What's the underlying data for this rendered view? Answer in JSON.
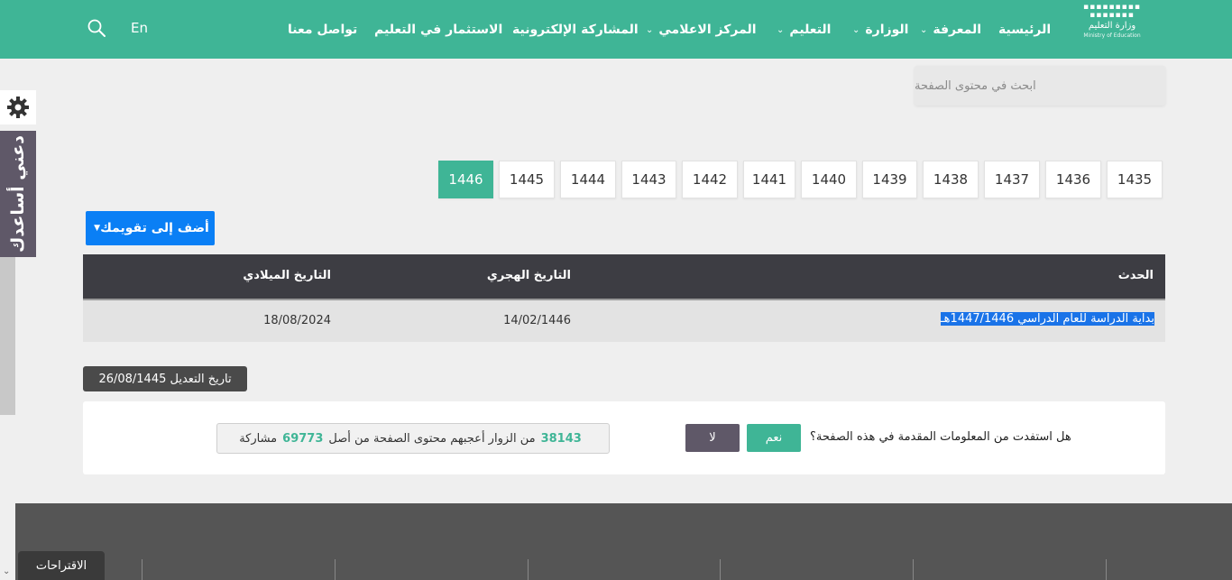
{
  "header": {
    "logo": {
      "arabic": "وزارة التعليم",
      "english": "Ministry of Education"
    },
    "nav": [
      {
        "label": "الرئيسية",
        "dropdown": false
      },
      {
        "label": "المعرفة",
        "dropdown": true
      },
      {
        "label": "الوزارة",
        "dropdown": true
      },
      {
        "label": "التعليم",
        "dropdown": true
      },
      {
        "label": "المركز الاعلامي",
        "dropdown": true
      },
      {
        "label": "المشاركة الإلكترونية",
        "dropdown": false
      },
      {
        "label": "الاستثمار في التعليم",
        "dropdown": false
      },
      {
        "label": "تواصل معنا",
        "dropdown": false
      }
    ],
    "lang_label": "En"
  },
  "page_search": {
    "placeholder": "ابحث في محتوى الصفحة"
  },
  "help_widget": {
    "label": "دعني أساعدك"
  },
  "years": [
    "1435",
    "1436",
    "1437",
    "1438",
    "1439",
    "1440",
    "1441",
    "1442",
    "1443",
    "1444",
    "1445",
    "1446"
  ],
  "active_year": "1446",
  "calendar_button": {
    "label": "أضف إلى تقويمك"
  },
  "table": {
    "headers": {
      "event": "الحدث",
      "hijri": "التاريخ الهجري",
      "gregorian": "التاريخ الميلادي"
    },
    "rows": [
      {
        "event": "بداية الدراسة للعام الدراسي 1447/1446هـ",
        "hijri": "14/02/1446",
        "gregorian": "18/08/2024"
      }
    ]
  },
  "modified_date": "تاريخ التعديل 26/08/1445",
  "feedback": {
    "question": "هل استفدت من المعلومات المقدمة في هذه الصفحة؟",
    "yes_label": "نعم",
    "no_label": "لا",
    "liked_count": "38143",
    "liked_text": "من الزوار أعجبهم محتوى الصفحة من أصل",
    "total_count": "69773",
    "total_text": "مشاركة"
  },
  "suggestions_label": "الاقتراحات",
  "colors": {
    "brand": "#3fb596",
    "header_table": "#3d3d43",
    "button_blue": "#0a7ff5"
  }
}
